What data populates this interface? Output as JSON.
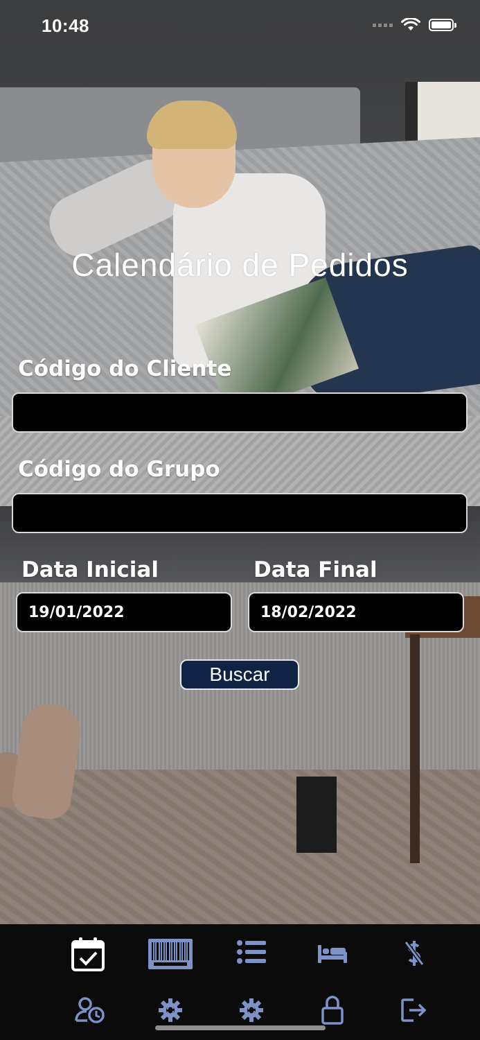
{
  "status_bar": {
    "time": "10:48"
  },
  "form": {
    "title": "Calendário de Pedidos",
    "client_code": {
      "label": "Código do Cliente",
      "value": ""
    },
    "group_code": {
      "label": "Código do Grupo",
      "value": ""
    },
    "start_date": {
      "label": "Data Inicial",
      "value": "19/01/2022"
    },
    "end_date": {
      "label": "Data Final",
      "value": "18/02/2022"
    },
    "search_button": "Buscar"
  },
  "tab_bar": {
    "icons_row1": [
      "calendar-check-icon",
      "barcode-icon",
      "list-icon",
      "bed-icon",
      "no-dollar-icon"
    ],
    "icons_row2": [
      "user-clock-icon",
      "gear-sync-icon",
      "gear-sync-icon",
      "lock-icon",
      "sign-out-icon"
    ]
  },
  "colors": {
    "tab_icon": "#7d93c7",
    "tab_icon_active": "#ffffff",
    "button_bg": "#102344",
    "tab_bar_bg": "#0b0b0b"
  }
}
